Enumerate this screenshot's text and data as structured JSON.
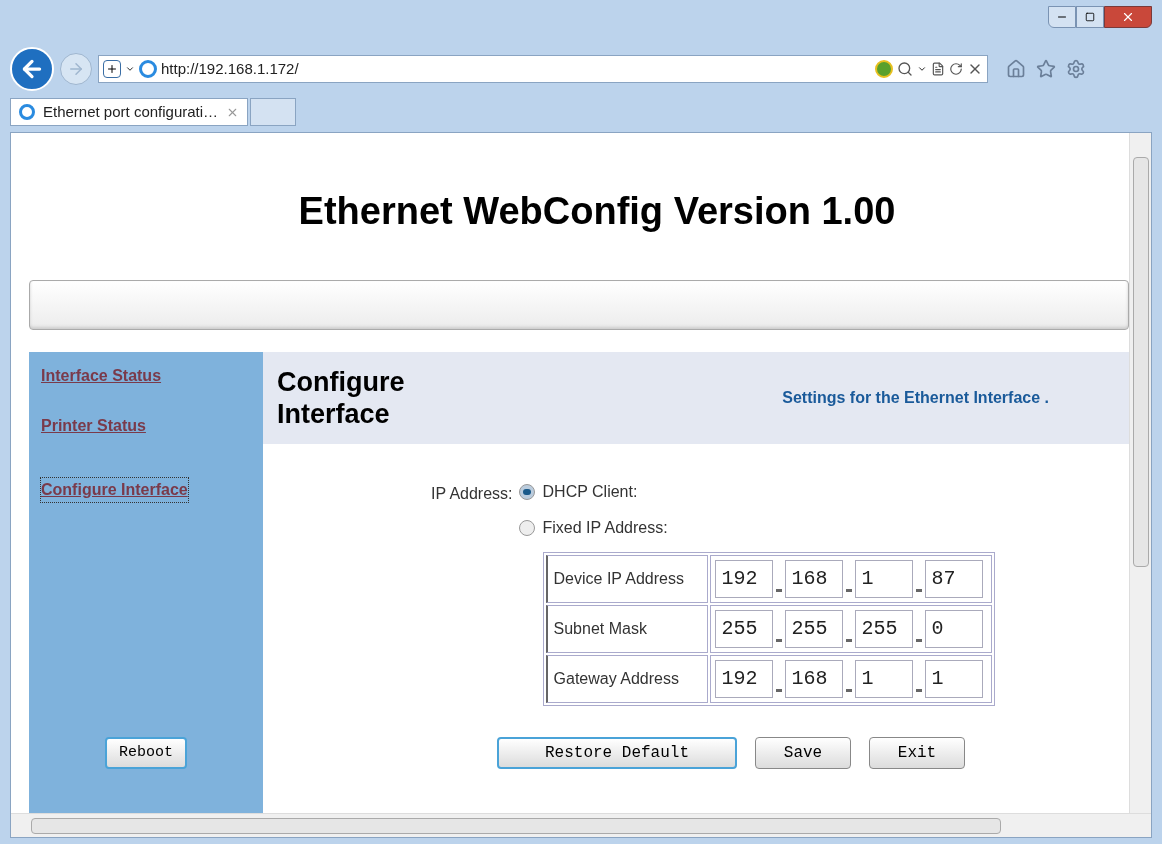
{
  "browser": {
    "address": "http://192.168.1.172/",
    "tabs": [
      {
        "label": "Ethernet port configurati…",
        "selected": true
      }
    ]
  },
  "page_title": "Ethernet WebConfig Version 1.00",
  "sidebar": {
    "links": [
      {
        "label": "Interface Status",
        "selected": false
      },
      {
        "label": "Printer Status",
        "selected": false
      },
      {
        "label": "Configure Interface",
        "selected": true
      }
    ],
    "reboot_button": "Reboot"
  },
  "section": {
    "title": "Configure Interface",
    "description": "Settings for the Ethernet Interface ."
  },
  "ip_address": {
    "label": "IP Address:",
    "options": [
      {
        "label": "DHCP Client:",
        "selected": true
      },
      {
        "label": "Fixed IP Address:",
        "selected": false
      }
    ]
  },
  "address_rows": [
    {
      "label": "Device IP Address",
      "octets": [
        "192",
        "168",
        "1",
        "87"
      ]
    },
    {
      "label": "Subnet Mask",
      "octets": [
        "255",
        "255",
        "255",
        "0"
      ]
    },
    {
      "label": "Gateway Address",
      "octets": [
        "192",
        "168",
        "1",
        "1"
      ]
    }
  ],
  "buttons": [
    {
      "label": "Restore Default",
      "focused": true
    },
    {
      "label": "Save",
      "focused": false
    },
    {
      "label": "Exit",
      "focused": false
    }
  ]
}
